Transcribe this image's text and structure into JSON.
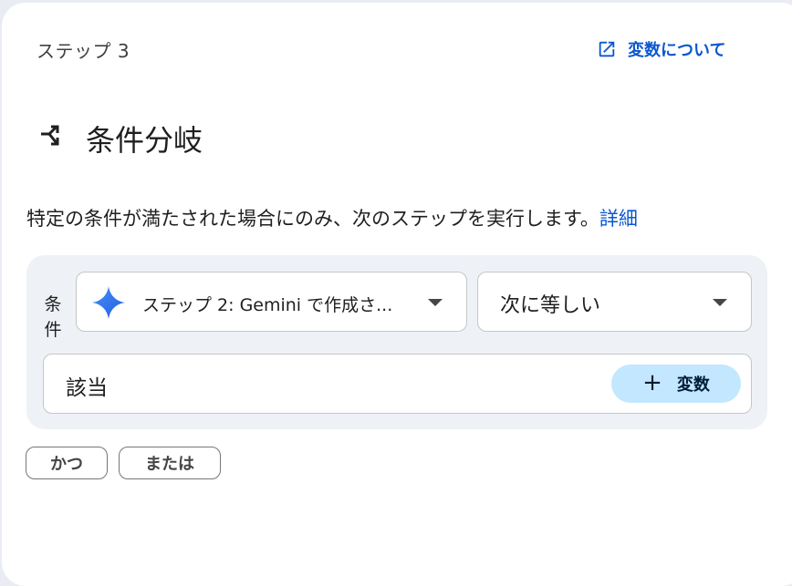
{
  "header": {
    "step_label": "ステップ 3",
    "vars_link_label": "変数について",
    "vars_link_icon": "open-in-new-icon"
  },
  "title": {
    "icon": "branch-icon",
    "text": "条件分岐"
  },
  "description": {
    "text": "特定の条件が満たされた場合にのみ、次のステップを実行します。",
    "link_label": "詳細"
  },
  "condition": {
    "label": "条件",
    "step_select": {
      "icon": "gemini-sparkle-icon",
      "value": "ステップ 2: Gemini で作成さ..."
    },
    "operator_select": {
      "value": "次に等しい"
    },
    "value_input": {
      "value": "該当"
    },
    "add_variable_button": {
      "icon": "plus",
      "label": "変数"
    }
  },
  "logic_buttons": {
    "and_label": "かつ",
    "or_label": "または"
  },
  "colors": {
    "link": "#0b57d0",
    "panel_bg": "#eef1f6",
    "chip_bg": "#c2e7ff"
  }
}
